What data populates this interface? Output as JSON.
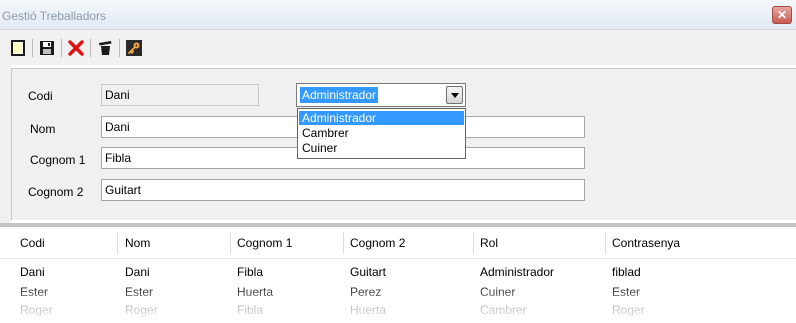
{
  "window": {
    "title": "Gestió Treballadors",
    "close_glyph": "✕"
  },
  "toolbar": {
    "buttons": [
      {
        "icon": "new-document-icon"
      },
      {
        "icon": "save-icon"
      },
      {
        "icon": "delete-icon"
      },
      {
        "icon": "trash-icon"
      },
      {
        "icon": "key-icon"
      }
    ]
  },
  "form": {
    "codi_label": "Codi",
    "codi_value": "Dani",
    "nom_label": "Nom",
    "nom_value": "Dani",
    "cognom1_label": "Cognom 1",
    "cognom1_value": "Fibla",
    "cognom2_label": "Cognom 2",
    "cognom2_value": "Guitart",
    "rol_selected": "Administrador",
    "rol_options": [
      "Administrador",
      "Cambrer",
      "Cuiner"
    ]
  },
  "table": {
    "headers": [
      "Codi",
      "Nom",
      "Cognom 1",
      "Cognom 2",
      "Rol",
      "Contrasenya"
    ],
    "rows": [
      [
        "Dani",
        "Dani",
        "Fibla",
        "Guitart",
        "Administrador",
        "fiblad"
      ],
      [
        "Ester",
        "Ester",
        "Huerta",
        "Perez",
        "Cuiner",
        "Ester"
      ],
      [
        "Roger",
        "Roger",
        "Fibla",
        "Huerta",
        "Cambrer",
        "Roger"
      ]
    ]
  },
  "colors": {
    "selection": "#3399ff",
    "delete": "#e01010",
    "panel": "#f0f0f0"
  }
}
